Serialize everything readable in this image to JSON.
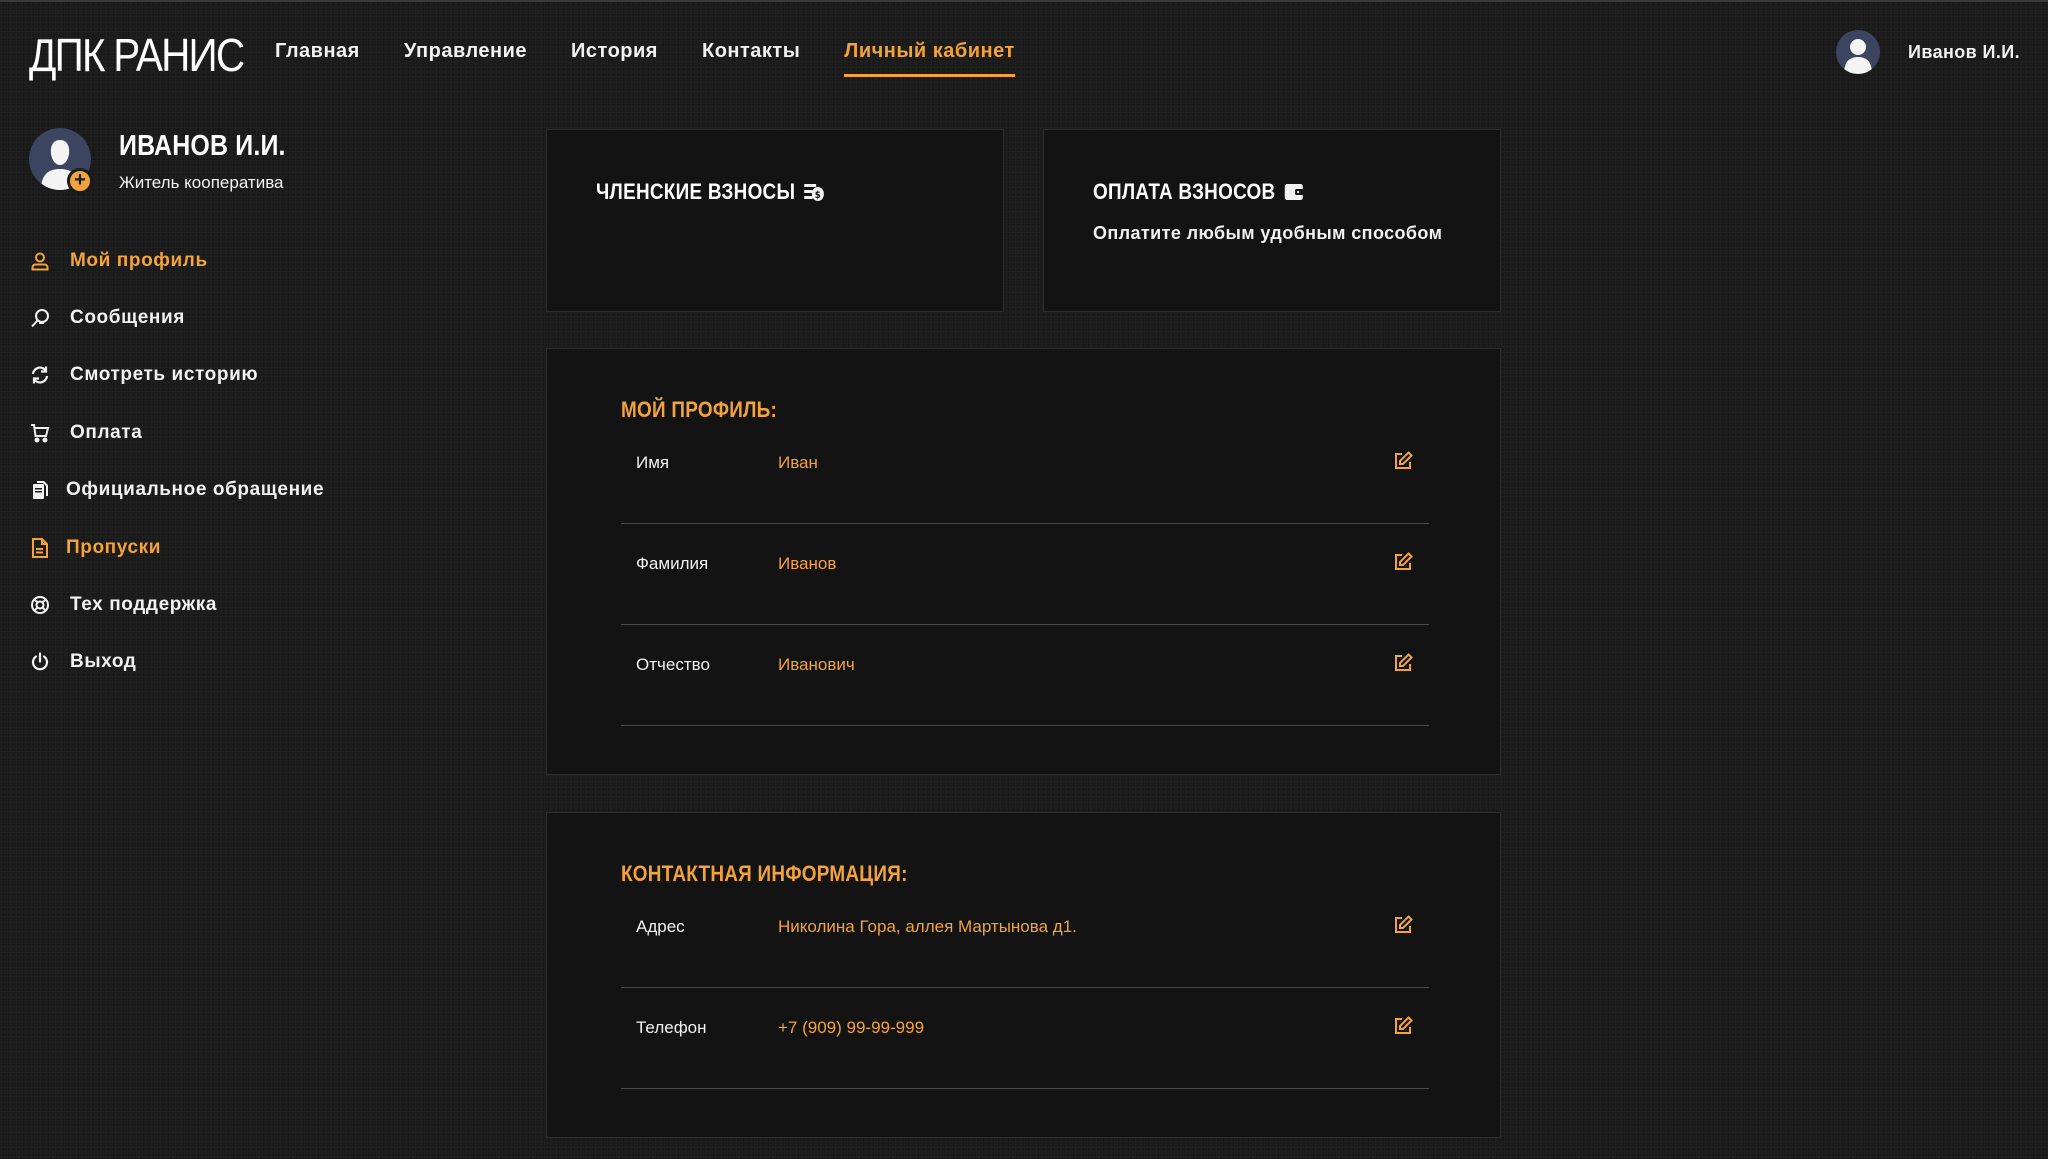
{
  "header": {
    "logo": "ДПК РАНИС",
    "nav": [
      {
        "label": "Главная",
        "active": false
      },
      {
        "label": "Управление",
        "active": false
      },
      {
        "label": "История",
        "active": false
      },
      {
        "label": "Контакты",
        "active": false
      },
      {
        "label": "Личный кабинет",
        "active": true
      }
    ],
    "user_name": "Иванов И.И."
  },
  "sidebar": {
    "profile": {
      "name": "ИВАНОВ И.И.",
      "role": "Житель кооператива"
    },
    "items": [
      {
        "label": "Мой профиль",
        "icon": "user-icon",
        "highlight": true
      },
      {
        "label": "Сообщения",
        "icon": "messages-icon",
        "highlight": false
      },
      {
        "label": "Смотреть историю",
        "icon": "history-icon",
        "highlight": false
      },
      {
        "label": "Оплата",
        "icon": "cart-icon",
        "highlight": false
      },
      {
        "label": "Официальное обращение",
        "icon": "documents-icon",
        "highlight": false
      },
      {
        "label": "Пропуски",
        "icon": "file-icon",
        "highlight": true
      },
      {
        "label": "Тех поддержка",
        "icon": "lifebuoy-icon",
        "highlight": false
      },
      {
        "label": "Выход",
        "icon": "power-icon",
        "highlight": false
      }
    ]
  },
  "cards": {
    "fees": {
      "title": "ЧЛЕНСКИЕ ВЗНОСЫ",
      "icon": "money-icon"
    },
    "payment": {
      "title": "ОПЛАТА ВЗНОСОВ",
      "icon": "wallet-icon",
      "subtitle": "Оплатите любым удобным способом"
    }
  },
  "profile_section": {
    "title": "МОЙ ПРОФИЛЬ:",
    "rows": [
      {
        "label": "Имя",
        "value": "Иван"
      },
      {
        "label": "Фамилия",
        "value": "Иванов"
      },
      {
        "label": "Отчество",
        "value": "Иванович"
      }
    ]
  },
  "contact_section": {
    "title": "КОНТАКТНАЯ ИНФОРМАЦИЯ:",
    "rows": [
      {
        "label": "Адрес",
        "value": "Николина Гора, аллея Мартынова д1."
      },
      {
        "label": "Телефон",
        "value": "+7 (909) 99-99-999"
      }
    ]
  },
  "colors": {
    "accent": "#f2a33c",
    "background": "#1b1b1b",
    "card": "#131313",
    "text": "#f2f2f2"
  }
}
